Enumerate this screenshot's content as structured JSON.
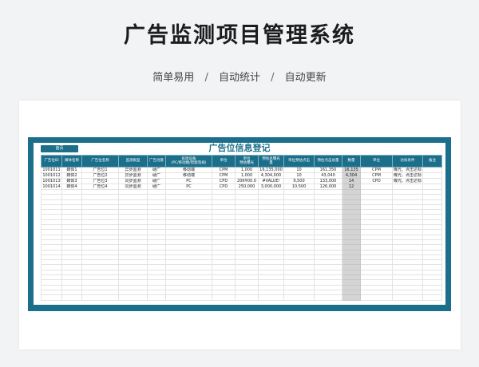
{
  "page": {
    "title": "广告监测项目管理系统",
    "tags": [
      "简单易用",
      "自动统计",
      "自动更新"
    ],
    "separator": "/"
  },
  "sheet": {
    "home_button": "首页",
    "title": "广告位信息登记",
    "columns": [
      "广告位ID",
      "媒体名称",
      "广告位名称",
      "监测类型",
      "广告创意",
      "投放设备\n(PC/移动端/智能电视)",
      "单位",
      "单位\n预估曝光",
      "预估总曝光\n量",
      "单位预估点击",
      "预估点击总量",
      "数量",
      "单位",
      "达标条件",
      "备注"
    ],
    "rows": [
      [
        "1001011",
        "媒体1",
        "广告位1",
        "异步监测",
        "硬广",
        "移动端",
        "CPM",
        "1,000",
        "16,135,000",
        "10",
        "161,350",
        "16,135",
        "CPM",
        "曝光、点击达标",
        ""
      ],
      [
        "1001012",
        "媒体2",
        "广告位2",
        "异步监测",
        "硬广",
        "移动端",
        "CPM",
        "1,000",
        "4,304,000",
        "10",
        "43,040",
        "4,304",
        "CPM",
        "曝光、点击达标",
        ""
      ],
      [
        "1001013",
        "媒体3",
        "广告位3",
        "同步监测",
        "硬广",
        "PC",
        "CPD",
        "20K¥00.0",
        "#VALUE!",
        "9,500",
        "133,000",
        "14",
        "CPD",
        "曝光、点击达标",
        ""
      ],
      [
        "1001014",
        "媒体4",
        "广告位4",
        "同步监测",
        "硬广",
        "PC",
        "CPD",
        "250,000",
        "3,000,000",
        "10,500",
        "126,000",
        "12",
        "",
        "",
        ""
      ]
    ],
    "highlight_column_index": 11,
    "empty_rows": 22
  },
  "colors": {
    "accent": "#1b6f8a",
    "highlight_column": "#d4d4d4",
    "background": "#f2f3f5"
  }
}
